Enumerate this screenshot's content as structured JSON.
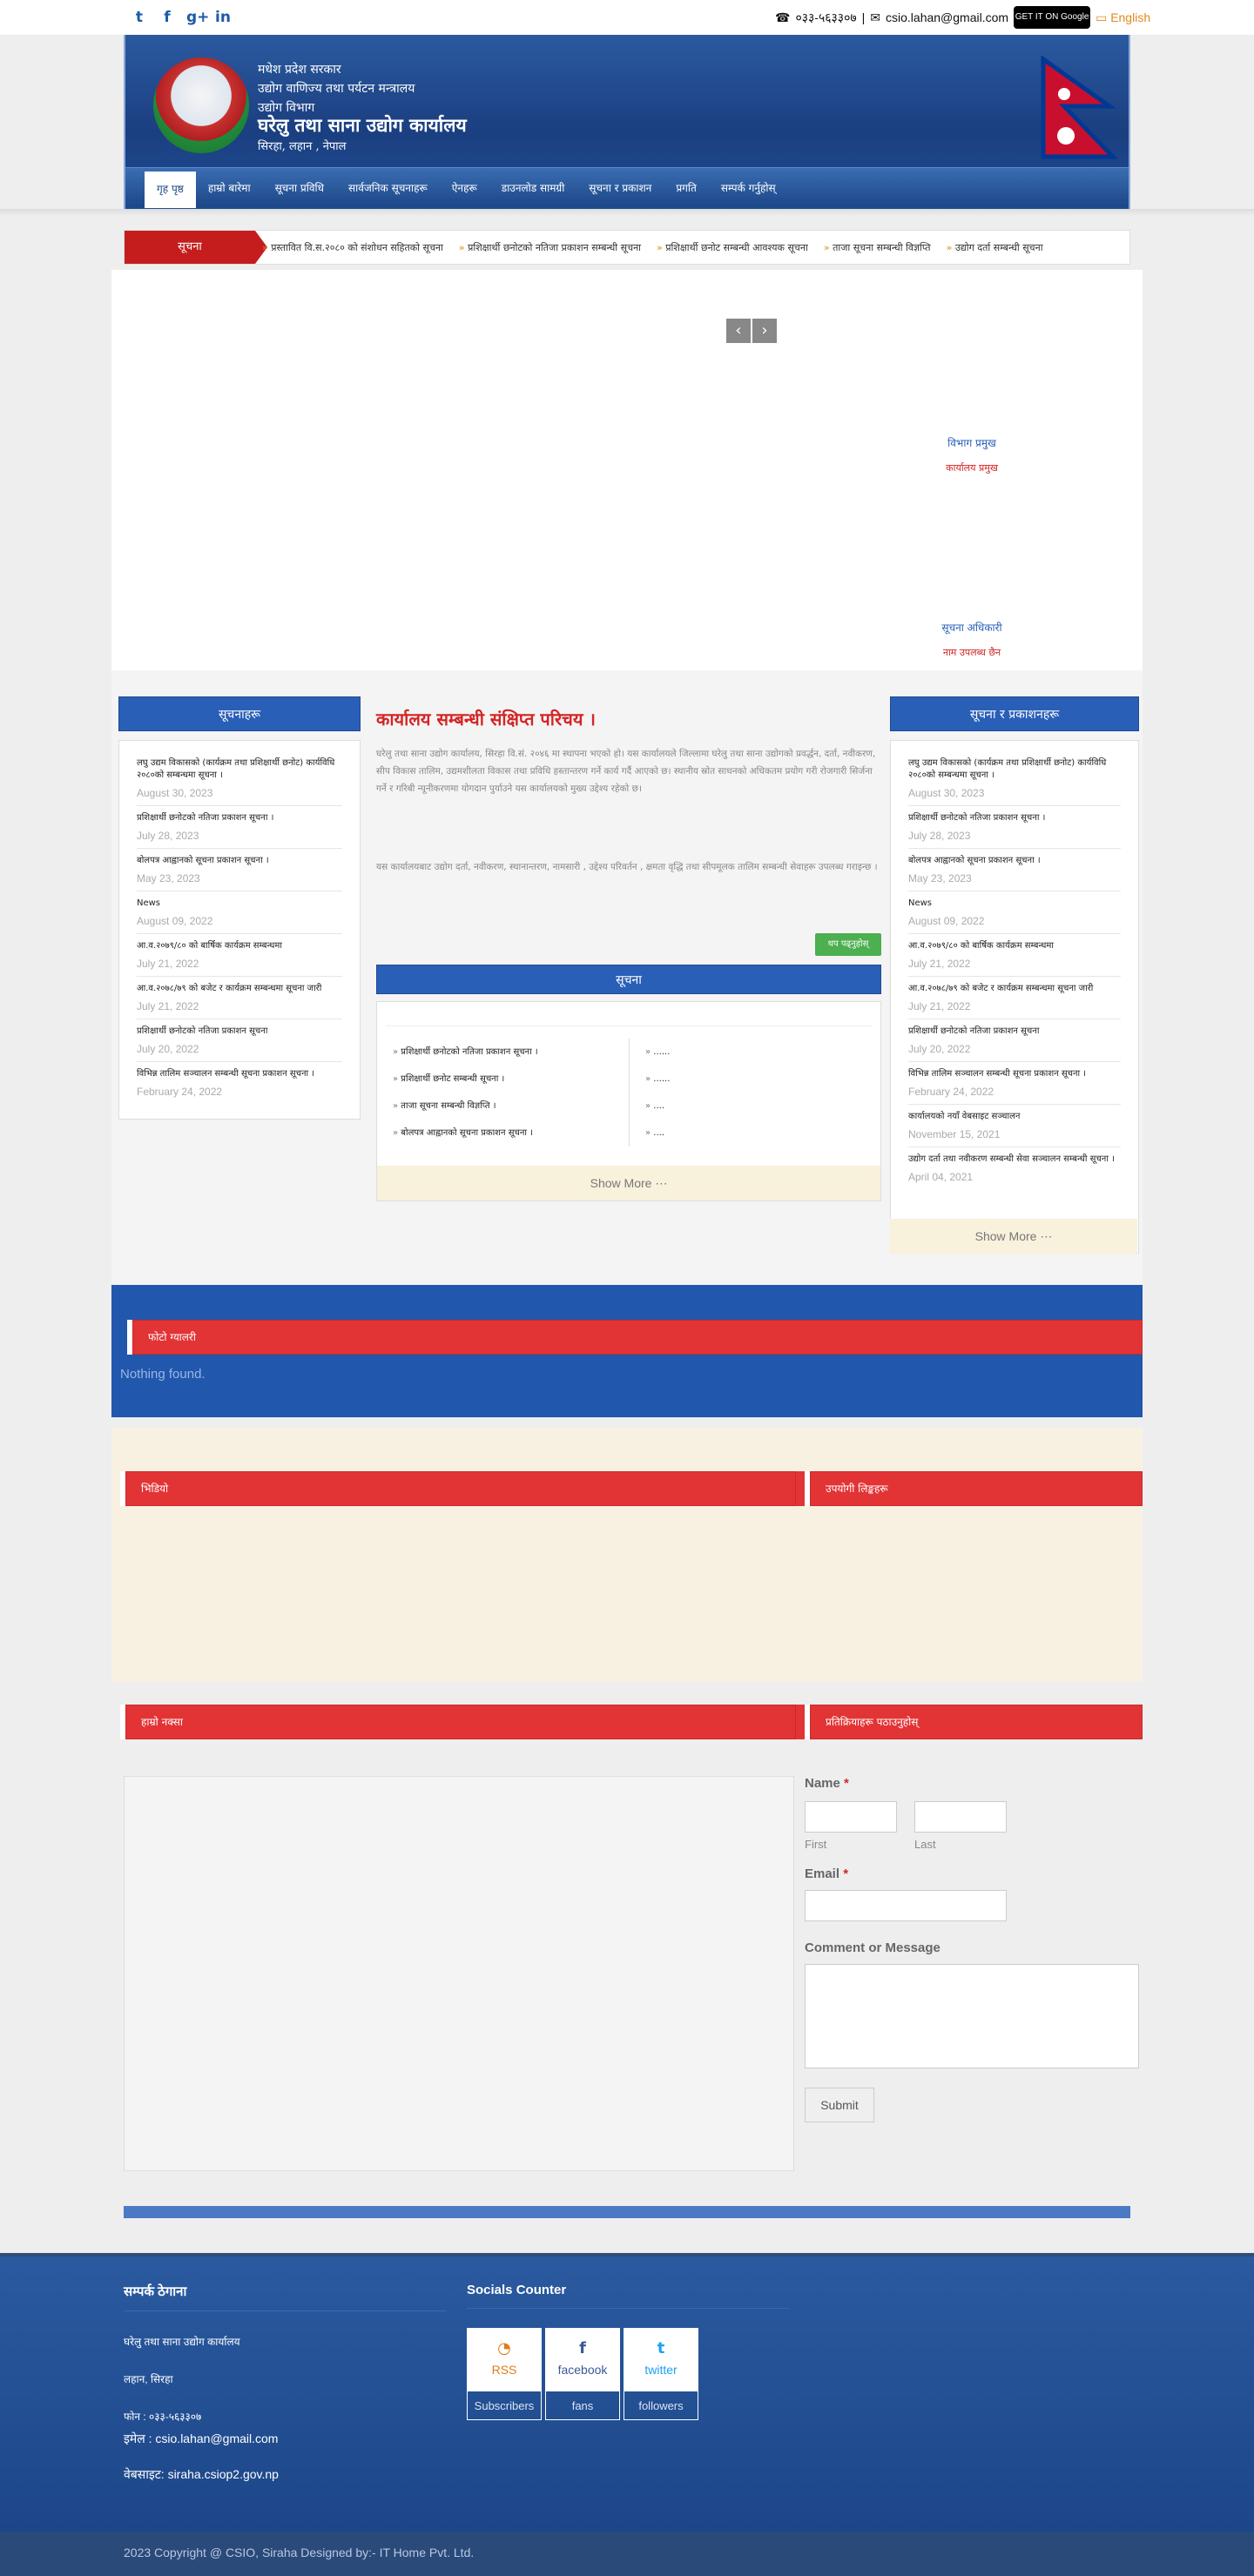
{
  "topbar": {
    "social_icons": [
      "twitter-icon",
      "facebook-icon",
      "google-plus-icon",
      "linkedin-icon"
    ],
    "phone_icon": "phone-icon",
    "phone": "०३३-५६३३०७",
    "separator": "|",
    "mail_icon": "mail-icon",
    "email": "csio.lahan@gmail.com",
    "google_play": "GET IT ON Google Play",
    "language": "English"
  },
  "header": {
    "line1": "मधेश प्रदेश सरकार",
    "line2": "उद्योग वाणिज्य तथा पर्यटन मन्त्रालय",
    "line3": "उद्योग विभाग",
    "title": "घरेलु तथा साना उद्योग कार्यालय",
    "address": "सिरहा, लहान , नेपाल"
  },
  "nav": [
    "गृह पृष्ठ",
    "हाम्रो बारेमा",
    "सूचना प्रविधि",
    "सार्वजनिक सूचनाहरू",
    "ऐनहरू",
    "डाउनलोड सामग्री",
    "सूचना र प्रकाशन",
    "प्रगति",
    "सम्पर्क गर्नुहोस्"
  ],
  "ticker": {
    "label": "सूचना",
    "items": [
      "प्रस्तावित वि.स.२०८० को संशोधन सहितको सूचना",
      "प्रशिक्षार्थी छनोटको नतिजा प्रकाशन सम्बन्धी सूचना",
      "प्रशिक्षार्थी छनोट सम्बन्धी आवश्यक सूचना",
      "ताजा सूचना सम्बन्धी विज्ञप्ति",
      "उद्योग दर्ता सम्बन्धी सूचना"
    ]
  },
  "slider": {
    "prev_label": "‹",
    "next_label": "›",
    "caption1_name": "विभाग प्रमुख",
    "caption1_role": "कार्यालय प्रमुख",
    "caption2_name": "सूचना अधिकारी",
    "caption2_role": "नाम उपलब्ध छैन"
  },
  "left_column": {
    "title": "सूचनाहरू",
    "items": [
      {
        "title": "लघु उद्यम विकासको (कार्यक्रम तथा प्रशिक्षार्थी छनोट) कार्यविधि २०८०को सम्बन्धमा सूचना ।",
        "date": "August 30, 2023"
      },
      {
        "title": "प्रशिक्षार्थी छनोटको नतिजा प्रकाशन सूचना ।",
        "date": "July 28, 2023"
      },
      {
        "title": "बोलपत्र आह्वानको सूचना प्रकाशन सूचना ।",
        "date": "May 23, 2023"
      },
      {
        "title": "News",
        "date": "August 09, 2022"
      },
      {
        "title": "आ.व.२०७९/८० को बार्षिक कार्यक्रम सम्बन्धमा",
        "date": "July 21, 2022"
      },
      {
        "title": "आ.व.२०७८/७९ को बजेट र कार्यक्रम सम्बन्धमा सूचना जारी",
        "date": "July 21, 2022"
      },
      {
        "title": "प्रशिक्षार्थी छनोटको नतिजा प्रकाशन सूचना",
        "date": "July 20, 2022"
      },
      {
        "title": "विभिन्न तालिम सञ्चालन सम्बन्धी सूचना प्रकाशन सूचना ।",
        "date": "February 24, 2022"
      }
    ]
  },
  "intro": {
    "title": "कार्यालय सम्बन्धी संक्षिप्त परिचय ।",
    "paragraph1": "घरेलु तथा साना उद्योग कार्यालय, सिरहा वि.सं. २०४६ मा स्थापना भएको हो। यस कार्यालयले जिल्लामा घरेलु तथा साना उद्योगको प्रवर्द्धन, दर्ता, नवीकरण, सीप विकास तालिम, उद्यमशीलता विकास तथा प्रविधि हस्तान्तरण गर्ने कार्य गर्दै आएको छ। स्थानीय स्रोत साधनको अधिकतम प्रयोग गरी रोजगारी सिर्जना गर्ने र गरिबी न्यूनीकरणमा योगदान पुर्याउने यस कार्यालयको मुख्य उद्देश्य रहेको छ।",
    "paragraph2": "यस कार्यालयबाट उद्योग दर्ता, नवीकरण, स्थानान्तरण, नामसारी , उद्देश्य परिवर्तन , क्षमता वृद्धि तथा सीपमूलक तालिम सम्बन्धी सेवाहरू उपलब्ध गराइन्छ ।",
    "read_more": "थप पढ्नुहोस्"
  },
  "notices": {
    "title": "सूचना",
    "left_items": [
      "प्रशिक्षार्थी छनोटको नतिजा प्रकाशन सूचना ।",
      "प्रशिक्षार्थी छनोट सम्बन्धी सूचना ।",
      "ताजा सूचना सम्बन्धी विज्ञप्ति ।",
      "बोलपत्र आह्वानको सूचना प्रकाशन सूचना ।"
    ],
    "right_items": [
      "......",
      "......",
      "....",
      "...."
    ],
    "show_more": "Show More ⋯"
  },
  "right_column": {
    "title": "सूचना र प्रकाशनहरू",
    "items": [
      {
        "title": "लघु उद्यम विकासको (कार्यक्रम तथा प्रशिक्षार्थी छनोट) कार्यविधि २०८०को सम्बन्धमा सूचना ।",
        "date": "August 30, 2023"
      },
      {
        "title": "प्रशिक्षार्थी छनोटको नतिजा प्रकाशन सूचना ।",
        "date": "July 28, 2023"
      },
      {
        "title": "बोलपत्र आह्वानको सूचना प्रकाशन सूचना ।",
        "date": "May 23, 2023"
      },
      {
        "title": "News",
        "date": "August 09, 2022"
      },
      {
        "title": "आ.व.२०७९/८० को बार्षिक कार्यक्रम सम्बन्धमा",
        "date": "July 21, 2022"
      },
      {
        "title": "आ.व.२०७८/७९ को बजेट र कार्यक्रम सम्बन्धमा सूचना जारी",
        "date": "July 21, 2022"
      },
      {
        "title": "प्रशिक्षार्थी छनोटको नतिजा प्रकाशन सूचना",
        "date": "July 20, 2022"
      },
      {
        "title": "विभिन्न तालिम सञ्चालन सम्बन्धी सूचना प्रकाशन सूचना ।",
        "date": "February 24, 2022"
      },
      {
        "title": "कार्यालयको नयाँ वेबसाइट सञ्चालन",
        "date": "November 15, 2021"
      },
      {
        "title": "उद्योग दर्ता तथा नवीकरण सम्बन्धी सेवा सञ्चालन सम्बन्धी सूचना ।",
        "date": "April 04, 2021"
      }
    ],
    "show_more": "Show More ⋯"
  },
  "blue_band": {
    "heading": "फोटो ग्यालरी",
    "empty_text": "Nothing found."
  },
  "cream_band": {
    "left_heading": "भिडियो",
    "right_heading": "उपयोगी लिङ्कहरू"
  },
  "map_form": {
    "left_heading": "हाम्रो नक्सा",
    "right_heading": "प्रतिक्रियाहरू पठाउनुहोस्",
    "name_label": "Name",
    "required_mark": "*",
    "first_label": "First",
    "last_label": "Last",
    "email_label": "Email",
    "comment_label": "Comment or Message",
    "submit": "Submit"
  },
  "footer": {
    "contact_title": "सम्पर्क ठेगाना",
    "office": "घरेलु तथा साना उद्योग कार्यालय",
    "place": "लहान, सिरहा",
    "phone": "फोन : ०३३-५६३३०७",
    "email": "इमेल : csio.lahan@gmail.com",
    "website": "वेबसाइट: siraha.csiop2.gov.np",
    "socials_title": "Socials Counter",
    "socials": [
      {
        "icon": "rss-icon",
        "name": "RSS",
        "unit": "Subscribers",
        "color": "#e47a1a"
      },
      {
        "icon": "facebook-icon",
        "name": "facebook",
        "unit": "fans",
        "color": "#3b5998"
      },
      {
        "icon": "twitter-icon",
        "name": "twitter",
        "unit": "followers",
        "color": "#1da1f2"
      }
    ],
    "copyright": "2023 Copyright @ CSIO, Siraha Designed by:- IT Home Pvt. Ltd."
  }
}
